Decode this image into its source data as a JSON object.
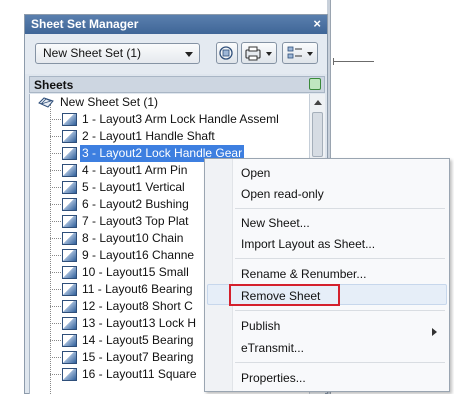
{
  "palette": {
    "title": "Sheet Set Manager",
    "close_glyph": "×",
    "sheet_set_dropdown": "New Sheet Set (1)",
    "section_header": "Sheets"
  },
  "tree": {
    "root": "New Sheet Set (1)",
    "sheets": [
      "1 - Layout3 Arm Lock Handle Asseml",
      "2 - Layout1 Handle Shaft",
      "3 - Layout2 Lock Handle Gear",
      "4 - Layout1 Arm Pin",
      "5 - Layout1 Vertical",
      "6 - Layout2 Bushing",
      "7 - Layout3 Top Plat",
      "8 - Layout10 Chain",
      "9 - Layout16 Channe",
      "10 - Layout15 Small",
      "11 - Layout6 Bearing",
      "12 - Layout8 Short C",
      "13 - Layout13 Lock H",
      "14 - Layout5 Bearing",
      "15 - Layout7 Bearing",
      "16 - Layout11 Square"
    ],
    "selected_index": 2
  },
  "context_menu": {
    "open": "Open",
    "open_read_only": "Open read-only",
    "new_sheet": "New Sheet...",
    "import_layout": "Import Layout as Sheet...",
    "rename_renumber": "Rename & Renumber...",
    "remove_sheet": "Remove Sheet",
    "publish": "Publish",
    "etransmit": "eTransmit...",
    "properties": "Properties..."
  },
  "colors": {
    "selection": "#3d7fe0",
    "highlight_box": "#d4202c"
  },
  "icons": {
    "toolbar": [
      "sheet-view-icon",
      "publish-icon",
      "views-list-icon"
    ],
    "tree_root": "sheet-set-icon",
    "tree_item": "sheet-icon",
    "section": "refresh-icon"
  }
}
